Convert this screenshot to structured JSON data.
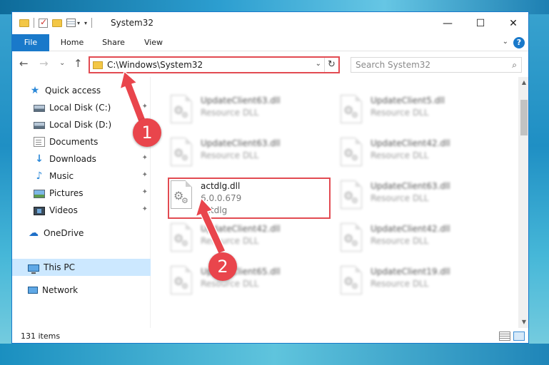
{
  "window": {
    "title": "System32",
    "minimize_icon": "minimize-icon",
    "maximize_icon": "maximize-icon",
    "close_icon": "close-icon",
    "controls": {
      "minimize": "—",
      "maximize": "☐",
      "close": "✕"
    }
  },
  "ribbon": {
    "tabs": [
      {
        "label": "File"
      },
      {
        "label": "Home"
      },
      {
        "label": "Share"
      },
      {
        "label": "View"
      }
    ],
    "help": "?",
    "collapse_caret": "⌄"
  },
  "nav": {
    "back": "←",
    "forward": "→",
    "recent": "⌄",
    "up": "↑",
    "address": "C:\\Windows\\System32",
    "address_dropdown": "⌄",
    "refresh": "↻",
    "search_placeholder": "Search System32",
    "search_glyph": "⌕"
  },
  "sidebar": {
    "items": [
      {
        "label": "Quick access",
        "icon": "star-icon",
        "pinned": false
      },
      {
        "label": "Local Disk (C:)",
        "icon": "disk-icon",
        "pinned": true
      },
      {
        "label": "Local Disk (D:)",
        "icon": "disk-icon",
        "pinned": false
      },
      {
        "label": "Documents",
        "icon": "documents-icon",
        "pinned": true
      },
      {
        "label": "Downloads",
        "icon": "downloads-icon",
        "pinned": true
      },
      {
        "label": "Music",
        "icon": "music-icon",
        "pinned": true
      },
      {
        "label": "Pictures",
        "icon": "pictures-icon",
        "pinned": true
      },
      {
        "label": "Videos",
        "icon": "videos-icon",
        "pinned": true
      },
      {
        "label": "OneDrive",
        "icon": "onedrive-icon",
        "pinned": false
      },
      {
        "label": "This PC",
        "icon": "this-pc-icon",
        "pinned": false,
        "selected": true
      },
      {
        "label": "Network",
        "icon": "network-icon",
        "pinned": false
      }
    ],
    "pin_glyph": "📌"
  },
  "files": {
    "highlighted": {
      "name": "actdlg.dll",
      "version": "6.0.0.679",
      "description": "actdlg"
    },
    "blurred": [
      {
        "name": "UpdateClient63.dll",
        "type": "Resource DLL"
      },
      {
        "name": "UpdateClient5.dll",
        "type": "Resource DLL"
      },
      {
        "name": "UpdateClient63.dll",
        "type": "Resource DLL"
      },
      {
        "name": "UpdateClient42.dll",
        "type": "Resource DLL"
      },
      {
        "name": "UpdateClient63.dll",
        "type": "Resource DLL"
      },
      {
        "name": "UpdateClient42.dll",
        "type": "Resource DLL"
      },
      {
        "name": "UpdateClient42.dll",
        "type": "Resource DLL"
      },
      {
        "name": "UpdateClient65.dll",
        "type": "Resource DLL"
      },
      {
        "name": "UpdateClient19.dll",
        "type": "Resource DLL"
      }
    ]
  },
  "status": {
    "item_count": "131 items"
  },
  "annotations": {
    "step1": "1",
    "step2": "2"
  },
  "colors": {
    "accent": "#1979ca",
    "highlight": "#e24b52",
    "callout": "#e9454c",
    "selected": "#cce8ff"
  }
}
